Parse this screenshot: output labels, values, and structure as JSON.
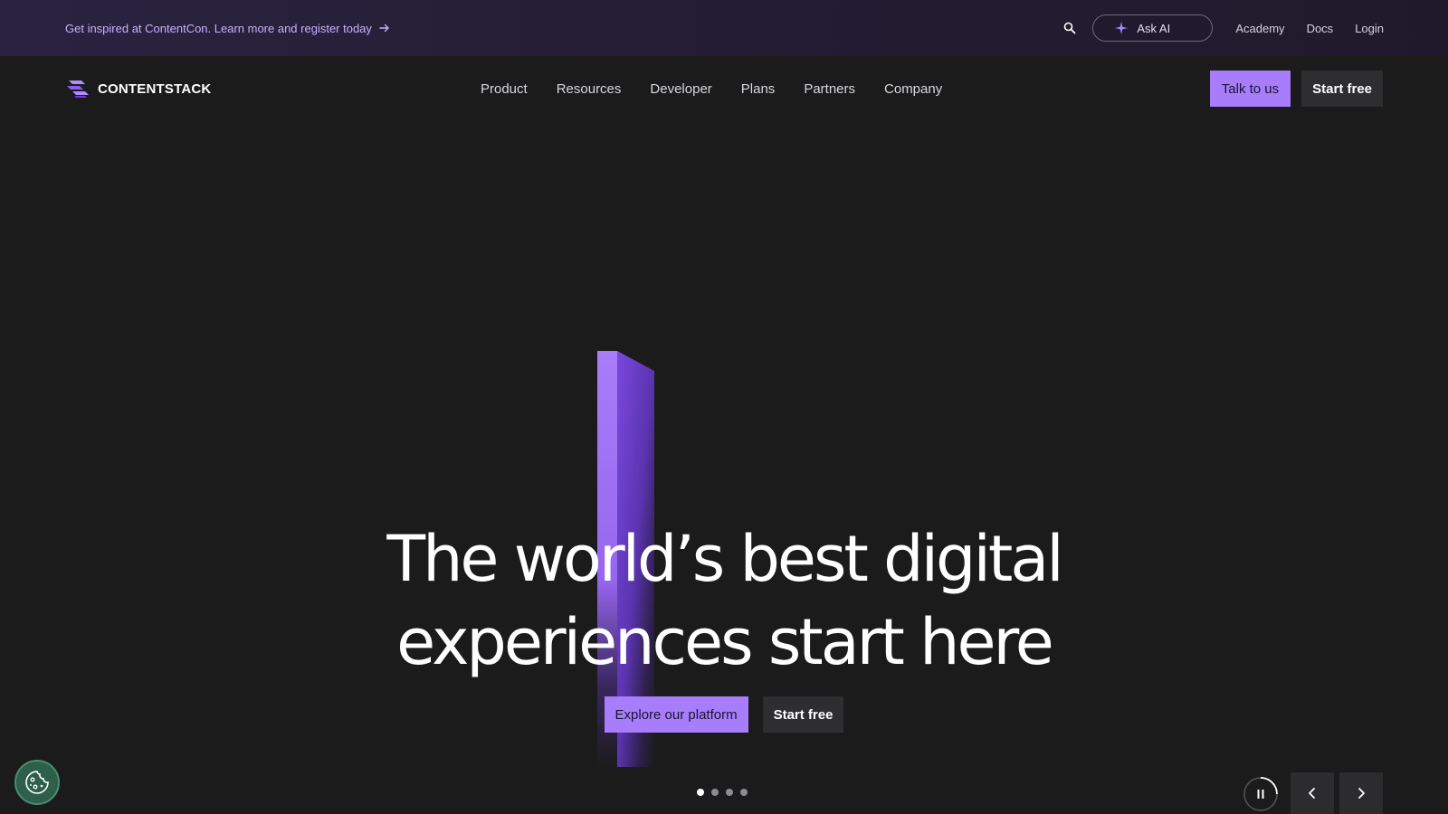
{
  "announcement": {
    "text": "Get inspired at ContentCon. Learn more and register today"
  },
  "utility": {
    "ask_ai": "Ask AI",
    "links": [
      "Academy",
      "Docs",
      "Login"
    ]
  },
  "nav": {
    "logo_text": "CONTENTSTACK",
    "items": [
      "Product",
      "Resources",
      "Developer",
      "Plans",
      "Partners",
      "Company"
    ],
    "talk_label": "Talk to us",
    "start_label": "Start free"
  },
  "hero": {
    "line1": "The world’s best digital",
    "line2": "experiences start here",
    "primary_cta": "Explore our platform",
    "secondary_cta": "Start free"
  },
  "carousel": {
    "slides": 4,
    "active_slide": 1
  },
  "colors": {
    "accent": "#a77dfb",
    "background": "#1b1b1c",
    "announce_text": "#c7b0ff"
  }
}
